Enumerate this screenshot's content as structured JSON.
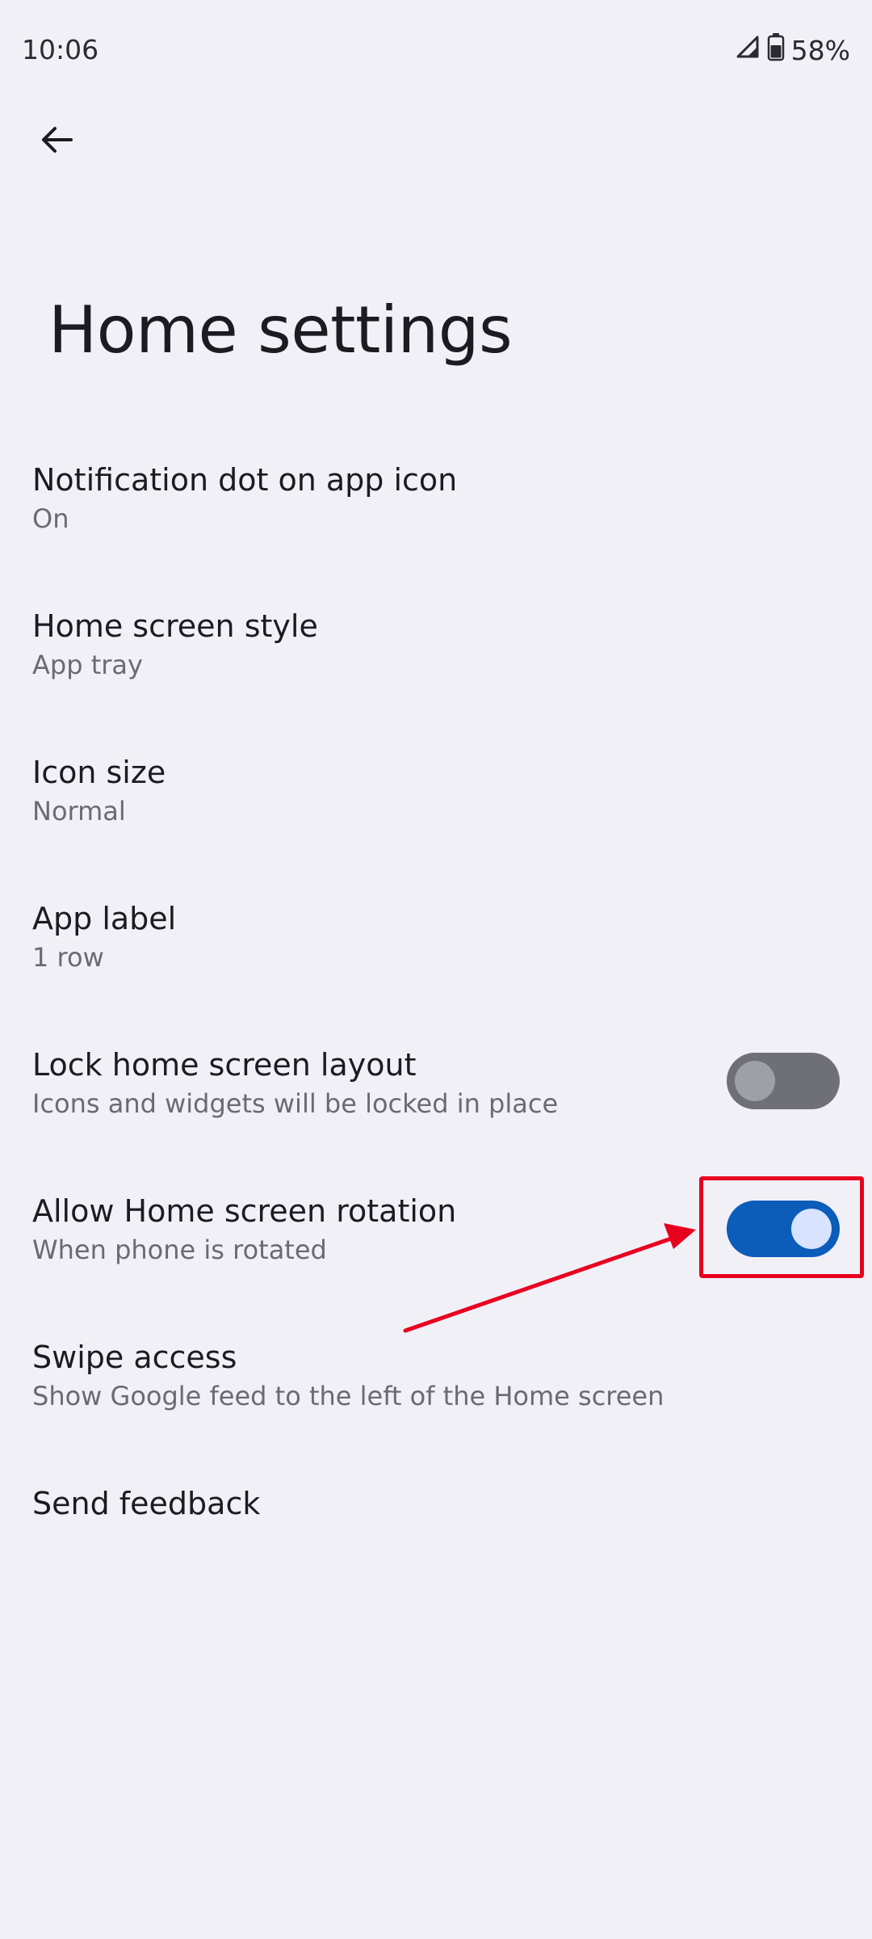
{
  "status_bar": {
    "time": "10:06",
    "battery": "58%",
    "signal_icon": "cellular-signal-icon",
    "battery_icon": "battery-icon"
  },
  "header": {
    "back_icon": "back-arrow-icon",
    "title": "Home settings"
  },
  "settings": [
    {
      "title": "Notification dot on app icon",
      "subtitle": "On"
    },
    {
      "title": "Home screen style",
      "subtitle": "App tray"
    },
    {
      "title": "Icon size",
      "subtitle": "Normal"
    },
    {
      "title": "App label",
      "subtitle": "1 row"
    },
    {
      "title": "Lock home screen layout",
      "subtitle": "Icons and widgets will be locked in place",
      "toggle": false
    },
    {
      "title": "Allow Home screen rotation",
      "subtitle": "When phone is rotated",
      "toggle": true
    },
    {
      "title": "Swipe access",
      "subtitle": "Show Google feed to the left of the Home screen"
    },
    {
      "title": "Send feedback"
    }
  ],
  "colors": {
    "background": "#f1f0f7",
    "toggle_on": "#0c5cba",
    "toggle_off": "#6f7077",
    "annotation": "#e8001f"
  }
}
